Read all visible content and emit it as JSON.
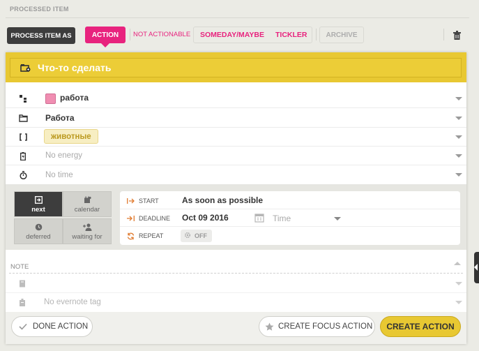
{
  "header": {
    "title": "PROCESSED ITEM"
  },
  "toolbar": {
    "process_label": "PROCESS ITEM AS",
    "action_label": "ACTION",
    "not_actionable_label": "NOT ACTIONABLE",
    "someday_label": "SOMEDAY/MAYBE",
    "tickler_label": "TICKLER",
    "archive_label": "ARCHIVE"
  },
  "item": {
    "title": "Что-то сделать",
    "area": "работа",
    "area_color": "#f08eb2",
    "project": "Работа",
    "tag": "животные",
    "energy_placeholder": "No energy",
    "time_placeholder": "No time"
  },
  "schedule": {
    "modes": [
      {
        "label": "next",
        "icon": "next-icon",
        "active": true
      },
      {
        "label": "calendar",
        "icon": "calendar-icon",
        "active": false
      },
      {
        "label": "deferred",
        "icon": "clock-icon",
        "active": false
      },
      {
        "label": "waiting for",
        "icon": "person-add-icon",
        "active": false
      }
    ],
    "start_label": "START",
    "start_value": "As soon as possible",
    "deadline_label": "DEADLINE",
    "deadline_value": "Oct 09 2016",
    "time_placeholder": "Time",
    "repeat_label": "REPEAT",
    "repeat_value": "OFF"
  },
  "note": {
    "label": "NOTE",
    "evernote_placeholder": "No evernote tag"
  },
  "footer": {
    "done_label": "DONE ACTION",
    "focus_label": "CREATE FOCUS ACTION",
    "create_label": "CREATE ACTION"
  },
  "colors": {
    "accent": "#e8237e",
    "yellow": "#e8c832",
    "dark": "#3d3d3d"
  }
}
